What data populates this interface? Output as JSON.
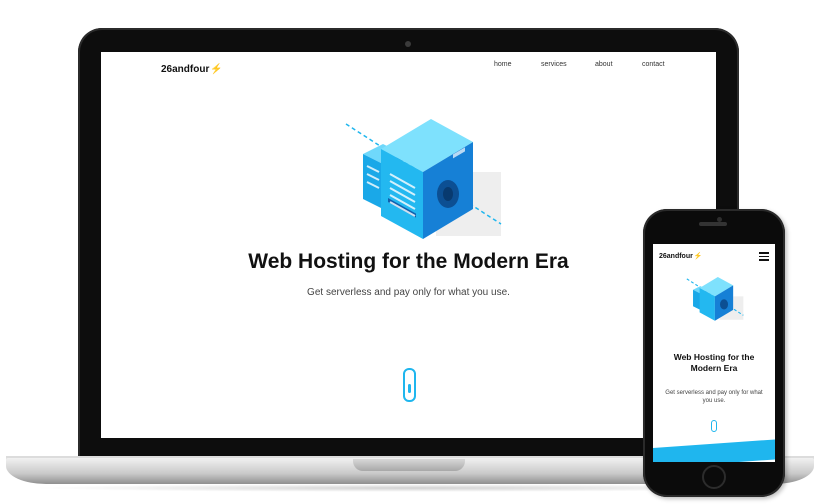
{
  "site": {
    "brand": "26andfour",
    "brand_mark": "⚡",
    "nav": [
      "home",
      "services",
      "about",
      "contact"
    ],
    "hero_title": "Web Hosting for the Modern Era",
    "hero_subtitle": "Get serverless and pay only for what you use."
  },
  "phone": {
    "brand": "26andfour",
    "hero_title": "Web Hosting for the Modern Era",
    "hero_subtitle": "Get serverless and pay only for what you use."
  },
  "colors": {
    "accent": "#1fb6ee",
    "accent_dark": "#1a7fd6",
    "device_frame": "#0d0d0d"
  },
  "icons": {
    "illustration": "server-cube-illustration",
    "scroll": "scroll-mouse-icon",
    "menu": "hamburger-menu-icon"
  }
}
